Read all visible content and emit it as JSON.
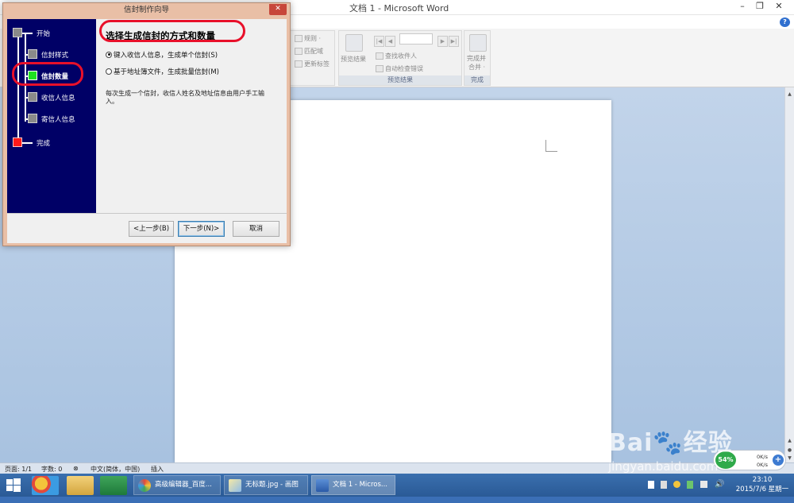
{
  "word": {
    "title": "文档 1 - Microsoft Word",
    "win_min": "–",
    "win_restore": "❐",
    "win_close": "✕",
    "help": "?"
  },
  "ribbon": {
    "rules": "规则 ·",
    "match_fields": "匹配域",
    "update_labels": "更新标签",
    "preview_results": "预览结果",
    "find_recipient": "查找收件人",
    "auto_check": "自动检查错误",
    "group_preview": "预览结果",
    "finish_merge_1": "完成并",
    "finish_merge_2": "合并 ·",
    "group_finish": "完成",
    "nav_first": "|◀",
    "nav_prev": "◀",
    "nav_next": "▶",
    "nav_last": "▶|"
  },
  "status": {
    "page": "页面: 1/1",
    "words": "字数: 0",
    "lang": "中文(简体，中国)",
    "insert": "插入"
  },
  "taskbar": {
    "task1": "高级编辑器_百度...",
    "task2": "无标题.jpg - 画图",
    "task3": "文档 1 - Micros...",
    "time": "23:10",
    "date": "2015/7/6 星期一"
  },
  "net": {
    "percent": "54%",
    "up": "0K/s",
    "down": "0K/s",
    "plus": "+"
  },
  "watermark": {
    "brand": "Bai",
    "brand2": "经验",
    "url": "jingyan.baidu.com"
  },
  "dialog": {
    "title": "信封制作向导",
    "close": "✕",
    "steps": [
      "开始",
      "信封样式",
      "信封数量",
      "收信人信息",
      "寄信人信息",
      "完成"
    ],
    "heading": "选择生成信封的方式和数量",
    "option1": "键入收信人信息，生成单个信封(S)",
    "option2": "基于地址簿文件，生成批量信封(M)",
    "description": "每次生成一个信封，收信人姓名及地址信息由用户手工输入。",
    "btn_prev": "<上一步(B)",
    "btn_next": "下一步(N)>",
    "btn_cancel": "取消"
  },
  "colors": {
    "highlight": "#e8102a",
    "current_step": "#1fe01f",
    "finish_step": "#ff1a1a",
    "wizard_panel": "#000066"
  }
}
